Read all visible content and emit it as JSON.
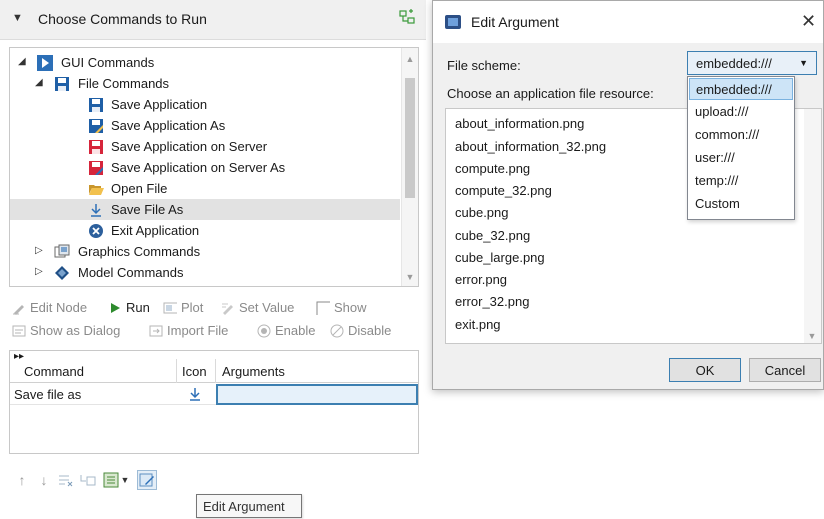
{
  "left_panel": {
    "header_title": "Choose Commands to Run",
    "tree": [
      {
        "label": "GUI Commands",
        "icon": "play-icon"
      },
      {
        "label": "File Commands",
        "icon": "save-icon"
      },
      {
        "label": "Save Application",
        "icon": "save-icon"
      },
      {
        "label": "Save Application As",
        "icon": "save-as-icon"
      },
      {
        "label": "Save Application on Server",
        "icon": "save-server-icon"
      },
      {
        "label": "Save Application on Server As",
        "icon": "save-server-as-icon"
      },
      {
        "label": "Open File",
        "icon": "folder-open-icon"
      },
      {
        "label": "Save File As",
        "icon": "download-arrow-icon"
      },
      {
        "label": "Exit Application",
        "icon": "exit-icon"
      },
      {
        "label": "Graphics Commands",
        "icon": "graphics-icon"
      },
      {
        "label": "Model Commands",
        "icon": "model-icon"
      }
    ],
    "toolbar": {
      "edit_node": "Edit Node",
      "run": "Run",
      "plot": "Plot",
      "set_value": "Set Value",
      "show": "Show",
      "show_as_dialog": "Show as Dialog",
      "import_file": "Import File",
      "enable": "Enable",
      "disable": "Disable"
    },
    "table": {
      "columns": [
        "Command",
        "Icon",
        "Arguments"
      ],
      "rows": [
        {
          "command": "Save file as",
          "icon": "download-arrow-icon",
          "arguments": ""
        }
      ]
    },
    "tooltip": "Edit Argument"
  },
  "dialog": {
    "title": "Edit Argument",
    "file_scheme_label": "File scheme:",
    "file_scheme_value": "embedded:///",
    "resource_label": "Choose an application file resource:",
    "files": [
      "about_information.png",
      "about_information_32.png",
      "compute.png",
      "compute_32.png",
      "cube.png",
      "cube_32.png",
      "cube_large.png",
      "error.png",
      "error_32.png",
      "exit.png"
    ],
    "scheme_options": [
      "embedded:///",
      "upload:///",
      "common:///",
      "user:///",
      "temp:///",
      "Custom"
    ],
    "ok": "OK",
    "cancel": "Cancel"
  },
  "colors": {
    "accent": "#3c7fb1",
    "selection": "#e2e2e2",
    "dropdown_highlight": "#cde4f7",
    "save_blue": "#1f5fa6",
    "save_red": "#d6253b"
  }
}
